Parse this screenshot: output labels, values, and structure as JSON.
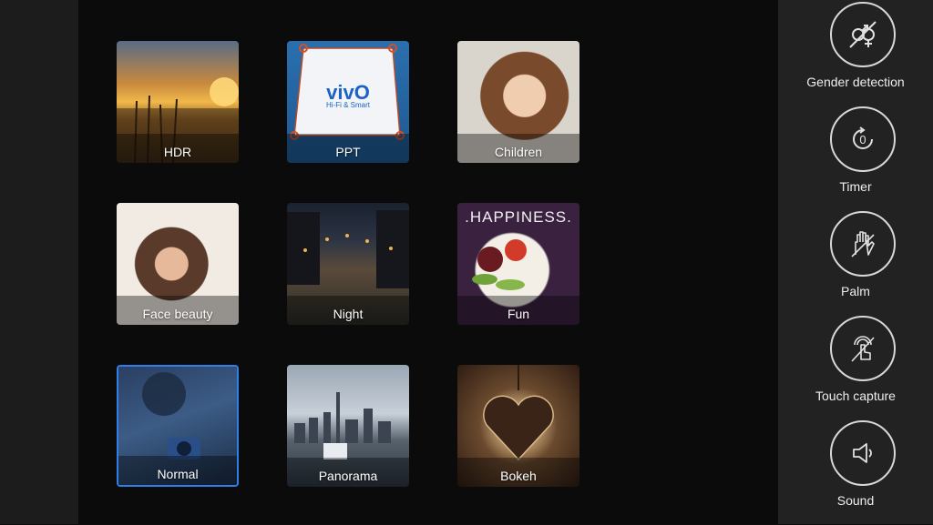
{
  "modes": [
    {
      "label": "HDR",
      "icon": "hdr-sunset-image",
      "selected": false
    },
    {
      "label": "PPT",
      "icon": "ppt-slide-image",
      "selected": false
    },
    {
      "label": "Children",
      "icon": "child-portrait-image",
      "selected": false
    },
    {
      "label": "Face beauty",
      "icon": "woman-portrait-image",
      "selected": false
    },
    {
      "label": "Night",
      "icon": "night-street-image",
      "selected": false
    },
    {
      "label": "Fun",
      "icon": "fun-food-image",
      "selected": false
    },
    {
      "label": "Normal",
      "icon": "camera-image",
      "selected": true
    },
    {
      "label": "Panorama",
      "icon": "city-skyline-image",
      "selected": false
    },
    {
      "label": "Bokeh",
      "icon": "heart-pendant-image",
      "selected": false
    }
  ],
  "ppt_overlay": {
    "brand": "vivO",
    "tagline": "Hi-Fi & Smart"
  },
  "fun_overlay": {
    "text": ".HAPPINESS."
  },
  "controls": [
    {
      "label": "Gender detection",
      "icon": "gender-detection-icon"
    },
    {
      "label": "Timer",
      "icon": "timer-icon"
    },
    {
      "label": "Palm",
      "icon": "palm-icon"
    },
    {
      "label": "Touch capture",
      "icon": "touch-capture-icon"
    },
    {
      "label": "Sound",
      "icon": "sound-icon"
    }
  ],
  "colors": {
    "selected_border": "#2f7fe6",
    "panel_bg": "#222222",
    "main_bg": "#0b0b0b"
  }
}
